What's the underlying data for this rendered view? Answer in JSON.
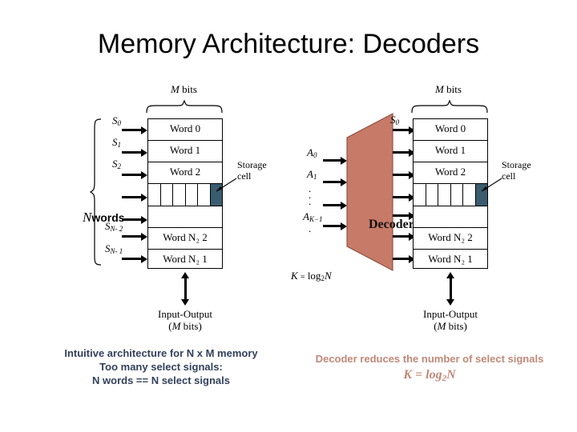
{
  "slide": {
    "title": "Memory Architecture: Decoders"
  },
  "left_diagram": {
    "top_label": {
      "var": "M",
      "text": " bits"
    },
    "brace_label_words": {
      "var": "N",
      "text": "words"
    },
    "select_signals": [
      {
        "base": "S",
        "sub": "0"
      },
      {
        "base": "S",
        "sub": "1"
      },
      {
        "base": "S",
        "sub": "2"
      },
      {
        "base": "",
        "sub": ""
      },
      {
        "base": "",
        "sub": ""
      },
      {
        "base": "S",
        "sub": "N- 2"
      },
      {
        "base": "S",
        "sub": "N- 1"
      }
    ],
    "words": [
      {
        "label": "Word 0"
      },
      {
        "label": "Word 1"
      },
      {
        "label": "Word 2"
      },
      {
        "label": ""
      },
      {
        "label": ""
      },
      {
        "label": "Word N₂ 2"
      },
      {
        "label": "Word N₂ 1"
      }
    ],
    "storage_cell_label_line1": "Storage",
    "storage_cell_label_line2": "cell",
    "io_line1": "Input-Output",
    "io_line2_pre": "(",
    "io_line2_var": "M",
    "io_line2_post": " bits)",
    "caption_line1": "Intuitive architecture for N x M memory",
    "caption_line2": "Too many select signals:",
    "caption_line3": "N words == N select signals"
  },
  "right_diagram": {
    "top_label": {
      "var": "M",
      "text": " bits"
    },
    "address_signals": [
      {
        "base": "A",
        "sub": "0"
      },
      {
        "base": "A",
        "sub": "1"
      },
      {
        "base": "",
        "sub": ""
      },
      {
        "base": "",
        "sub": ""
      },
      {
        "base": "A",
        "sub": "K−1"
      },
      {
        "base": "",
        "sub": ""
      }
    ],
    "decoder_label": "Decoder",
    "decoder_color": "#c87a68",
    "first_select_signal": {
      "base": "S",
      "sub": "0"
    },
    "k_formula_k": "K",
    "k_formula_eq": "=",
    "k_formula_log": "log",
    "k_formula_sub": "2",
    "k_formula_n": "N",
    "words": [
      {
        "label": "Word 0"
      },
      {
        "label": "Word 1"
      },
      {
        "label": "Word 2"
      },
      {
        "label": ""
      },
      {
        "label": ""
      },
      {
        "label": "Word N₂ 2"
      },
      {
        "label": "Word N₂ 1"
      }
    ],
    "storage_cell_label_line1": "Storage",
    "storage_cell_label_line2": "cell",
    "io_line1": "Input-Output",
    "io_line2_pre": "(",
    "io_line2_var": "M",
    "io_line2_post": " bits)",
    "caption_line1": "Decoder reduces the number of select signals",
    "caption_formula_k": "K",
    "caption_formula_eq": " = ",
    "caption_formula_log": "log",
    "caption_formula_sub": "2",
    "caption_formula_n": "N"
  },
  "colors": {
    "storage_cell": "#3a5c6e",
    "decoder": "#c87a68",
    "left_caption": "#33415c",
    "right_caption": "#c08878",
    "background": "#ffffff"
  },
  "icons": {
    "select_arrow": "right-arrow-icon",
    "io_arrow": "double-vertical-arrow-icon",
    "brace": "curly-brace-icon",
    "pointer": "pointer-line-icon"
  }
}
